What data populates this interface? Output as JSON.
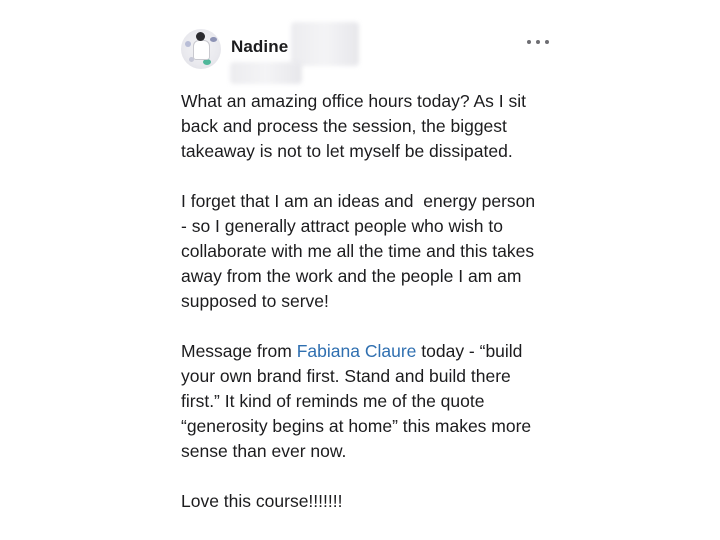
{
  "post": {
    "author_name": "Nadine",
    "paragraph1": [
      "What an amazing office hours today? As I sit",
      "back and process the session, the biggest",
      "takeaway is not to let myself be dissipated."
    ],
    "paragraph2": [
      "I forget that I am an ideas and  energy person",
      "- so I generally attract people who wish to",
      "collaborate with me all the time and this takes",
      "away from the work and the people I am am",
      "supposed to serve!"
    ],
    "paragraph3": {
      "line1_before": "Message from ",
      "line1_mention": "Fabiana Claure",
      "line1_after": " today - “build",
      "rest": [
        "your own brand first. Stand and build there",
        "first.” It kind of reminds me of the quote",
        "“generosity begins at home” this makes more",
        "sense than ever now."
      ]
    },
    "paragraph4": "Love this course!!!!!!!"
  },
  "icons": {
    "more": "more-horizontal-icon",
    "avatar": "profile-photo"
  },
  "colors": {
    "text": "#1c1c1e",
    "mention": "#2f6fb0",
    "icon": "#6e6e73"
  }
}
